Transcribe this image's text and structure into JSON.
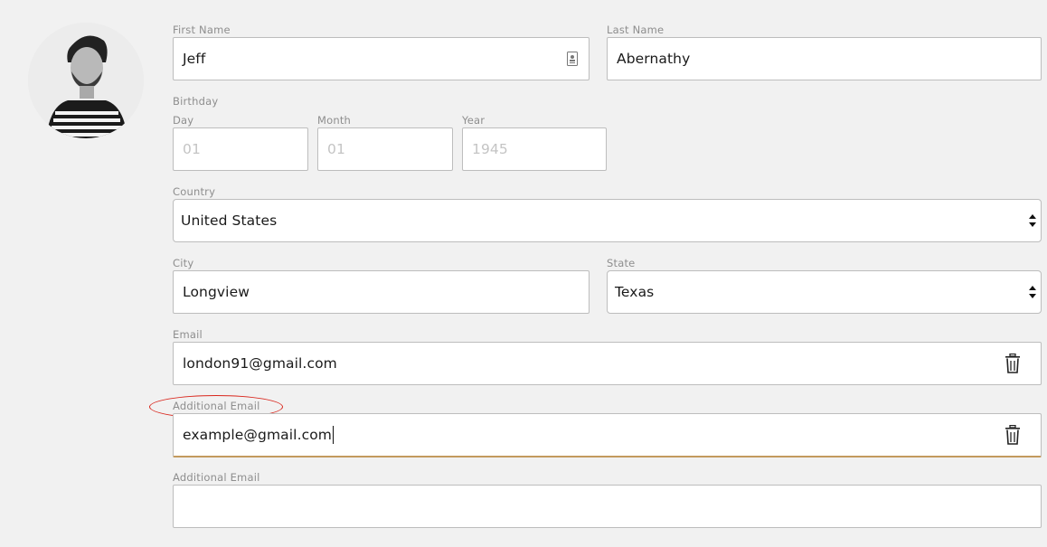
{
  "profile": {
    "first_name_label": "First Name",
    "first_name": "Jeff",
    "last_name_label": "Last Name",
    "last_name": "Abernathy",
    "birthday_label": "Birthday",
    "day_label": "Day",
    "day_value": "01",
    "month_label": "Month",
    "month_value": "01",
    "year_label": "Year",
    "year_value": "1945",
    "country_label": "Country",
    "country": "United States",
    "city_label": "City",
    "city": "Longview",
    "state_label": "State",
    "state": "Texas",
    "email_label": "Email",
    "email": "london91@gmail.com",
    "additional_email_label": "Additional Email",
    "additional_email": "example@gmail.com",
    "additional_email2_label": "Additional Email",
    "additional_email2": ""
  },
  "colors": {
    "background": "#f1f1f1",
    "active_underline": "#c39a5e",
    "highlight_ellipse": "#d9261c"
  },
  "icons": {
    "select": "up-down-arrows-icon",
    "delete": "trash-icon",
    "contact_card": "contact-card-icon"
  }
}
